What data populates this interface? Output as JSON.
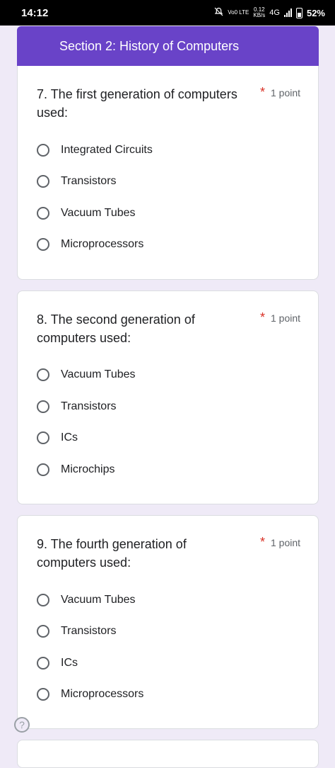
{
  "status_bar": {
    "time": "14:12",
    "net_label": "Vo0 LTE",
    "speed": "0.12",
    "speed_unit": "KB/s",
    "network_type": "4G",
    "battery": "52%"
  },
  "section": {
    "title": "Section 2: History of Computers"
  },
  "questions": [
    {
      "title": "7. The first generation of computers used:",
      "required_mark": "*",
      "points": "1 point",
      "options": [
        "Integrated Circuits",
        "Transistors",
        "Vacuum Tubes",
        "Microprocessors"
      ]
    },
    {
      "title": "8. The second generation of computers used:",
      "required_mark": "*",
      "points": "1 point",
      "options": [
        "Vacuum Tubes",
        "Transistors",
        "ICs",
        "Microchips"
      ]
    },
    {
      "title": "9. The fourth generation of computers used:",
      "required_mark": "*",
      "points": "1 point",
      "options": [
        "Vacuum Tubes",
        "Transistors",
        "ICs",
        "Microprocessors"
      ]
    }
  ],
  "help": {
    "icon": "help-icon",
    "glyph": "?"
  },
  "colors": {
    "accent": "#6943c8",
    "background": "#efeaf7",
    "required": "#d93025"
  }
}
